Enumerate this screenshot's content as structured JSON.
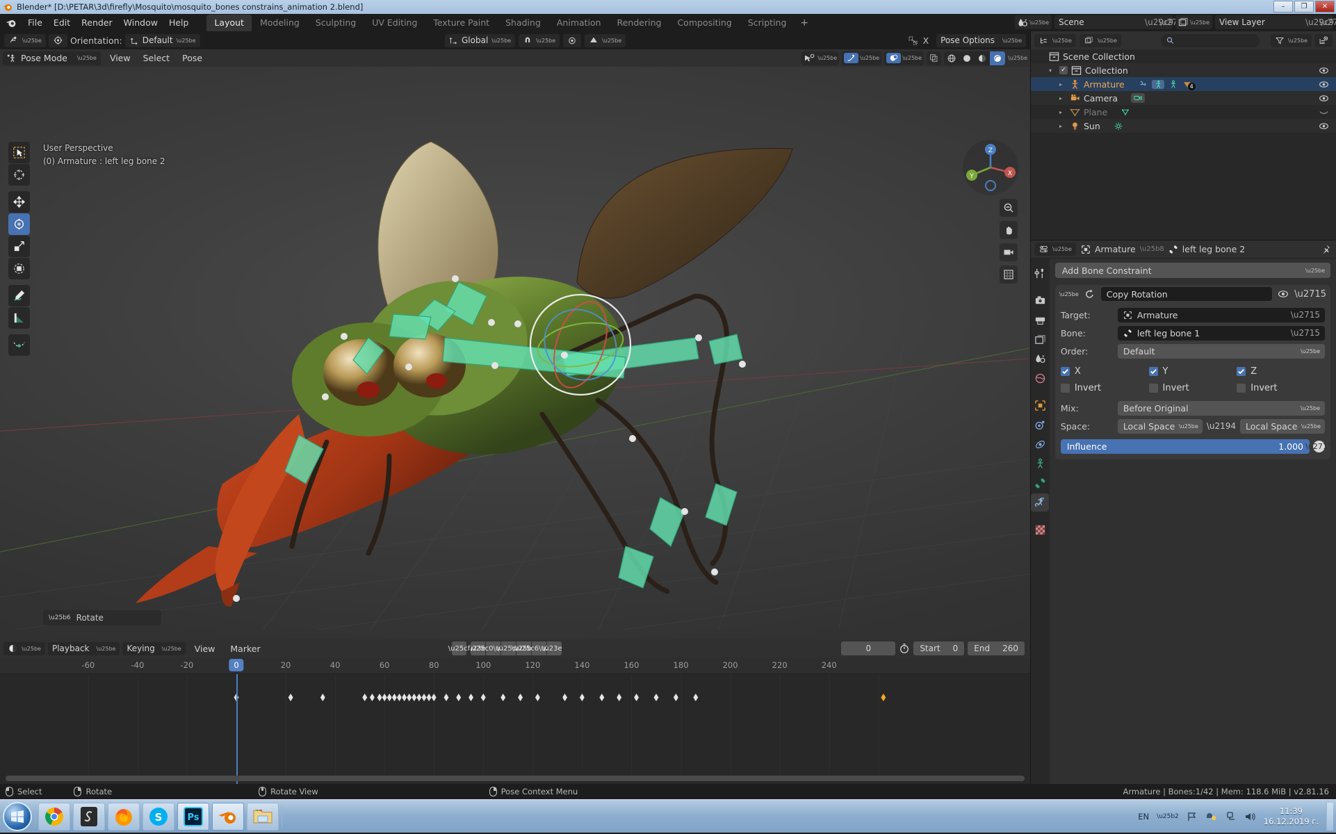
{
  "window": {
    "title": "Blender* [D:\\PETAR\\3d\\firefly\\Mosquito\\mosquito_bones constrains_animation 2.blend]",
    "minimize": "–",
    "maximize": "❐",
    "close": "✕"
  },
  "topbar": {
    "menus": [
      "File",
      "Edit",
      "Render",
      "Window",
      "Help"
    ],
    "workspaces": [
      {
        "label": "Layout",
        "active": true
      },
      {
        "label": "Modeling",
        "active": false
      },
      {
        "label": "Sculpting",
        "active": false
      },
      {
        "label": "UV Editing",
        "active": false
      },
      {
        "label": "Texture Paint",
        "active": false
      },
      {
        "label": "Shading",
        "active": false
      },
      {
        "label": "Animation",
        "active": false
      },
      {
        "label": "Rendering",
        "active": false
      },
      {
        "label": "Compositing",
        "active": false
      },
      {
        "label": "Scripting",
        "active": false
      }
    ],
    "add_workspace": "+",
    "scene_name": "Scene",
    "view_layer_name": "View Layer"
  },
  "toolheader": {
    "orientation_label": "Orientation:",
    "orientation_value": "Default",
    "transform_value": "Global",
    "proportional_x": "X",
    "pose_options": "Pose Options"
  },
  "viewport": {
    "mode": "Pose Mode",
    "menus": [
      "View",
      "Select",
      "Pose"
    ],
    "overlay_line1": "User Perspective",
    "overlay_line2": "(0) Armature : left leg bone 2",
    "operator_panel": "Rotate",
    "gizmo_axes": {
      "x": "X",
      "y": "Y",
      "z": "Z"
    }
  },
  "outliner": {
    "search_placeholder": "",
    "rows": [
      {
        "label": "Scene Collection",
        "indent": 0,
        "icon": "collection-icon",
        "selected": false,
        "dim": false,
        "eye": false,
        "checkbox": false,
        "tri": false
      },
      {
        "label": "Collection",
        "indent": 1,
        "icon": "collection-icon",
        "selected": false,
        "dim": false,
        "eye": true,
        "checkbox": true,
        "tri": true
      },
      {
        "label": "Armature",
        "indent": 2,
        "icon": "armature-icon",
        "selected": true,
        "dim": false,
        "eye": true,
        "checkbox": false,
        "tri": true,
        "badge": "4"
      },
      {
        "label": "Camera",
        "indent": 2,
        "icon": "camera-icon",
        "selected": false,
        "dim": false,
        "eye": true,
        "checkbox": false,
        "tri": true
      },
      {
        "label": "Plane",
        "indent": 2,
        "icon": "mesh-icon",
        "selected": false,
        "dim": true,
        "eye": false,
        "checkbox": false,
        "tri": true
      },
      {
        "label": "Sun",
        "indent": 2,
        "icon": "light-icon",
        "selected": false,
        "dim": false,
        "eye": true,
        "checkbox": false,
        "tri": true
      }
    ]
  },
  "properties": {
    "breadcrumb_object": "Armature",
    "breadcrumb_bone": "left leg bone 2",
    "add_constraint_label": "Add Bone Constraint",
    "constraint": {
      "name": "Copy Rotation",
      "target_label": "Target:",
      "target_value": "Armature",
      "bone_label": "Bone:",
      "bone_value": "left leg bone 1",
      "order_label": "Order:",
      "order_value": "Default",
      "axes": [
        {
          "label": "X",
          "enabled": true,
          "invert_label": "Invert",
          "invert": false
        },
        {
          "label": "Y",
          "enabled": true,
          "invert_label": "Invert",
          "invert": false
        },
        {
          "label": "Z",
          "enabled": true,
          "invert_label": "Invert",
          "invert": false
        }
      ],
      "mix_label": "Mix:",
      "mix_value": "Before Original",
      "space_label": "Space:",
      "space_from": "Local Space",
      "space_to": "Local Space",
      "influence_label": "Influence",
      "influence_value": "1.000"
    }
  },
  "timeline": {
    "menus": [
      "Playback",
      "Keying",
      "View",
      "Marker"
    ],
    "current_frame": "0",
    "start_label": "Start",
    "start_value": "0",
    "end_label": "End",
    "end_value": "260",
    "ruler_ticks": [
      "-60",
      "-40",
      "-20",
      "0",
      "20",
      "40",
      "60",
      "80",
      "100",
      "120",
      "140",
      "160",
      "180",
      "200",
      "220",
      "240"
    ],
    "playhead_frame": 0,
    "keyframes": [
      0,
      22,
      35,
      52,
      55,
      58,
      60,
      62,
      64,
      66,
      68,
      70,
      72,
      74,
      76,
      78,
      80,
      85,
      90,
      95,
      100,
      108,
      115,
      122,
      133,
      140,
      148,
      155,
      162,
      170,
      178,
      186
    ],
    "selected_keyframe": 262
  },
  "statusbar": {
    "items": [
      {
        "icon": "mouse-left-icon",
        "label": "Select"
      },
      {
        "icon": "mouse-right-icon",
        "label": "Rotate"
      },
      {
        "icon": "mouse-middle-icon",
        "label": "Rotate View"
      },
      {
        "icon": "mouse-right-icon",
        "label": "Pose Context Menu"
      }
    ],
    "info": "Armature | Bones:1/42  | Mem: 118.6 MiB | v2.81.16"
  },
  "taskbar": {
    "apps": [
      "chrome-icon",
      "substance-icon",
      "firefox-icon",
      "skype-icon",
      "photoshop-icon",
      "blender-icon",
      "explorer-icon"
    ],
    "language": "EN",
    "time": "11:39",
    "date": "16.12.2019 г."
  }
}
